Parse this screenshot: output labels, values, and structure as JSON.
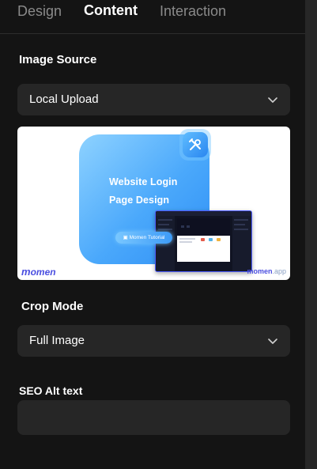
{
  "tabs": [
    {
      "label": "Design",
      "active": false
    },
    {
      "label": "Content",
      "active": true
    },
    {
      "label": "Interaction",
      "active": false
    }
  ],
  "image_source": {
    "label": "Image Source",
    "selected": "Local Upload"
  },
  "preview": {
    "headline_line1": "Website Login",
    "headline_line2": "Page Design",
    "pill_text": "Momen Tutorial",
    "logo_left": "omen",
    "logo_left_initial": "m",
    "logo_right_brand": "momen",
    "logo_right_tld": ".app",
    "badge_icon": "tools-icon",
    "colors": {
      "card": "#4aa8fb",
      "brand": "#4b4fe0"
    }
  },
  "crop_mode": {
    "label": "Crop Mode",
    "selected": "Full Image"
  },
  "seo_alt": {
    "label": "SEO Alt text",
    "value": "",
    "placeholder": ""
  },
  "colors": {
    "background": "#141414",
    "field": "#262626",
    "tab_inactive": "#8a8a8a",
    "scrollbar": "#272727"
  }
}
